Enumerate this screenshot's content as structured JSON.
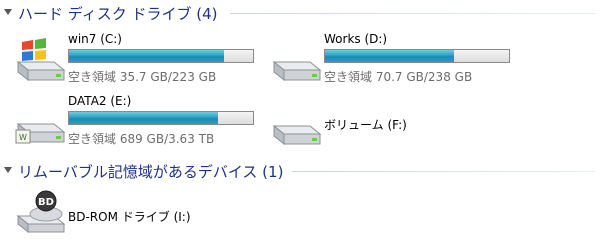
{
  "groups": [
    {
      "title": "ハード ディスク ドライブ (4)"
    },
    {
      "title": "リムーバブル記憶域があるデバイス (1)"
    }
  ],
  "drives": [
    {
      "name": "win7 (C:)",
      "free_text": "空き領域 35.7 GB/223 GB",
      "used_fraction": 0.84,
      "icon": "windows-drive-icon"
    },
    {
      "name": "Works (D:)",
      "free_text": "空き領域 70.7 GB/238 GB",
      "used_fraction": 0.7,
      "icon": "hard-drive-icon"
    },
    {
      "name": "DATA2 (E:)",
      "free_text": "空き領域 689 GB/3.63 TB",
      "used_fraction": 0.81,
      "icon": "hard-drive-icon"
    },
    {
      "name": "ボリューム (F:)",
      "icon": "hard-drive-icon"
    }
  ],
  "removable": [
    {
      "name": "BD-ROM ドライブ (I:)",
      "badge": "BD",
      "icon": "bd-rom-drive-icon"
    }
  ],
  "colors": {
    "header_text": "#1e3287",
    "bar_fill": "#2aa3c4",
    "free_text": "#6d6d6d"
  }
}
